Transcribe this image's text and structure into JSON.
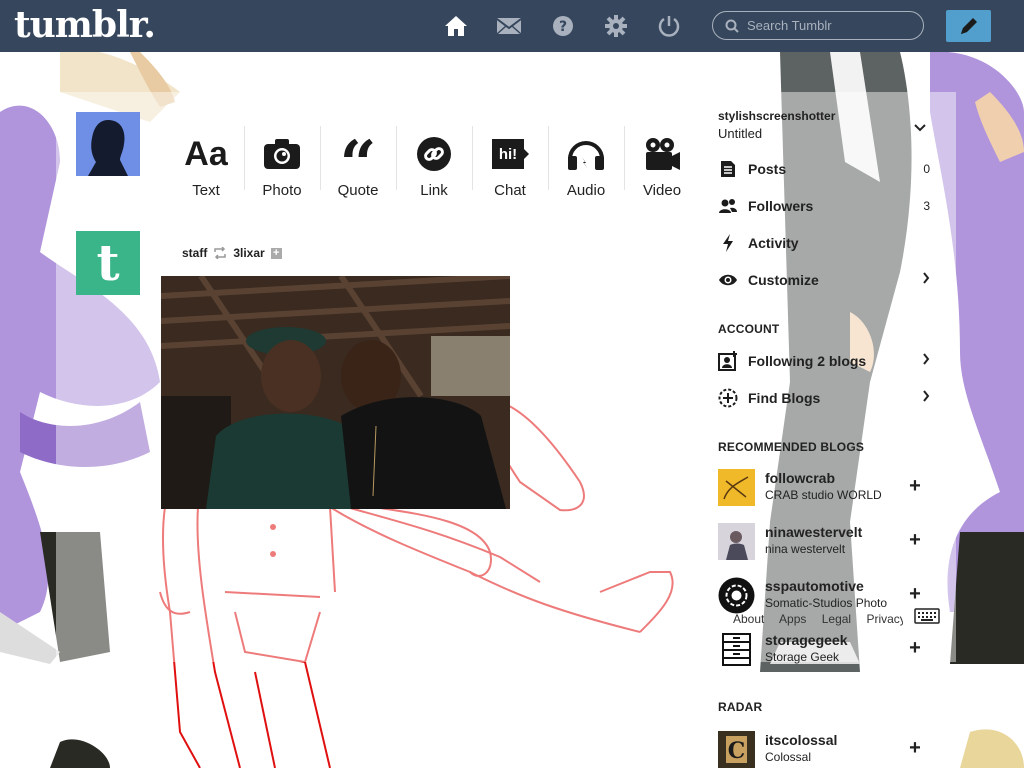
{
  "header": {
    "logo": "tumblr.",
    "nav_icons": [
      "home-icon",
      "mail-icon",
      "help-icon",
      "gear-icon",
      "power-icon"
    ],
    "search_placeholder": "Search Tumblr",
    "compose_icon": "pencil-icon"
  },
  "post_types": [
    {
      "label": "Text",
      "icon": "text-icon"
    },
    {
      "label": "Photo",
      "icon": "camera-icon"
    },
    {
      "label": "Quote",
      "icon": "quote-icon"
    },
    {
      "label": "Link",
      "icon": "link-icon"
    },
    {
      "label": "Chat",
      "icon": "chat-icon"
    },
    {
      "label": "Audio",
      "icon": "headphones-icon"
    },
    {
      "label": "Video",
      "icon": "video-camera-icon"
    }
  ],
  "post": {
    "author": "staff",
    "reblogged_from": "3lixar"
  },
  "sidebar": {
    "blog_name": "stylishscreenshotter",
    "blog_title": "Untitled",
    "rows": [
      {
        "label": "Posts",
        "count": "0"
      },
      {
        "label": "Followers",
        "count": "3"
      },
      {
        "label": "Activity",
        "count": ""
      },
      {
        "label": "Customize",
        "count": ""
      }
    ],
    "account_heading": "ACCOUNT",
    "account_rows": [
      {
        "label": "Following 2 blogs"
      },
      {
        "label": "Find Blogs"
      }
    ],
    "recommended_heading": "RECOMMENDED BLOGS",
    "recommended": [
      {
        "name": "followcrab",
        "subtitle": "CRAB studio WORLD"
      },
      {
        "name": "ninawestervelt",
        "subtitle": "nina westervelt"
      },
      {
        "name": "sspautomotive",
        "subtitle": "Somatic-Studios Photo"
      },
      {
        "name": "storagegeek",
        "subtitle": "Storage Geek"
      }
    ],
    "radar_heading": "RADAR",
    "radar": [
      {
        "name": "itscolossal",
        "subtitle": "Colossal"
      }
    ],
    "footer_links": [
      "About",
      "Apps",
      "Legal",
      "Privacy"
    ]
  },
  "colors": {
    "topbar": "#36465d",
    "accent": "#529ecc",
    "staff_avatar": "#3ab58a",
    "sketch": "#e01010"
  }
}
